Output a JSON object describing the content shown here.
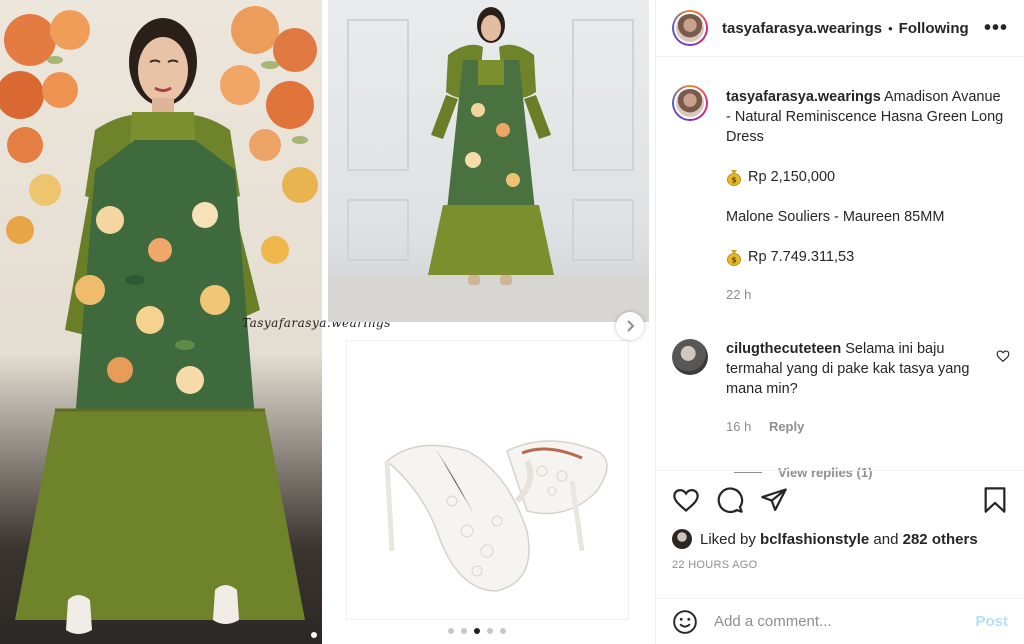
{
  "media": {
    "watermark": "Tasyafarasya.wearings",
    "carousel_dots": 5,
    "active_dot": 2
  },
  "header": {
    "username": "tasyafarasya.wearings",
    "separator": "•",
    "follow_status": "Following",
    "more": "•••"
  },
  "caption": {
    "username": "tasyafarasya.wearings",
    "text": "Amadison Avanue - Natural Reminiscence Hasna Green Long Dress",
    "price1": "Rp 2,150,000",
    "line2": "Malone Souliers - Maureen 85MM",
    "price2": "Rp 7.749.311,53",
    "time": "22 h"
  },
  "comment": {
    "username": "cilugthecuteteen",
    "text": "Selama ini baju termahal yang di pake kak tasya yang mana min?",
    "time": "16 h",
    "reply_label": "Reply",
    "view_replies": "View replies (1)"
  },
  "likes": {
    "prefix": "Liked by",
    "user": "bclfashionstyle",
    "conj": "and",
    "others": "282 others"
  },
  "timestamp": "22 HOURS AGO",
  "add_comment": {
    "placeholder": "Add a comment...",
    "post_label": "Post"
  },
  "colors": {
    "dress_green": "#7b8f2e",
    "post_disabled": "#b2dffc",
    "muted_text": "#8e8e8e"
  }
}
